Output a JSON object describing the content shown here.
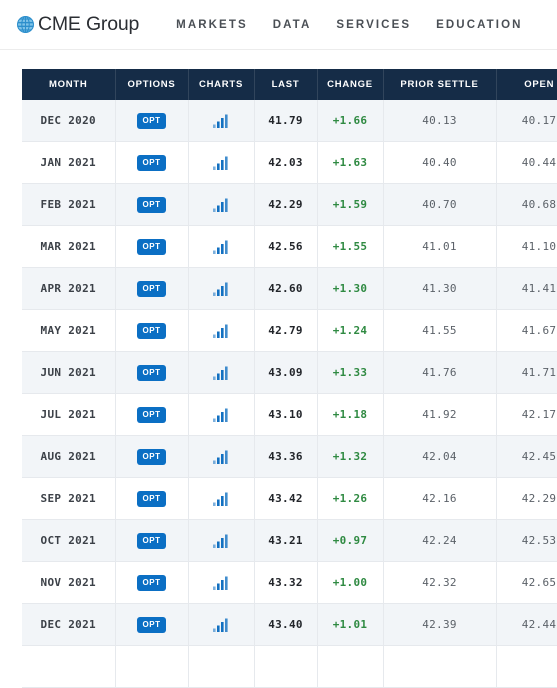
{
  "header": {
    "brand": {
      "name": "CME Group",
      "logo_icon": "globe-icon",
      "logo_color": "#4a9fd8"
    },
    "nav": [
      {
        "label": "MARKETS"
      },
      {
        "label": "DATA"
      },
      {
        "label": "SERVICES"
      },
      {
        "label": "EDUCATION"
      }
    ]
  },
  "quotes_table": {
    "columns": [
      {
        "key": "month",
        "label": "MONTH"
      },
      {
        "key": "options",
        "label": "OPTIONS"
      },
      {
        "key": "charts",
        "label": "CHARTS"
      },
      {
        "key": "last",
        "label": "LAST"
      },
      {
        "key": "change",
        "label": "CHANGE"
      },
      {
        "key": "prior",
        "label": "PRIOR SETTLE"
      },
      {
        "key": "open",
        "label": "OPEN"
      }
    ],
    "colors": {
      "header_bg": "#152c47",
      "header_text": "#ffffff",
      "row_alt_bg": "#f2f5f8",
      "row_bg": "#ffffff",
      "change_positive": "#2f8a42",
      "badge_bg": "#0b6fc4",
      "chart_icon": "#1270c1"
    },
    "option_badge_label": "OPT",
    "option_badge_icon": "opt-badge-icon",
    "chart_cell_icon": "bar-chart-icon",
    "rows": [
      {
        "month": "DEC 2020",
        "options": "OPT",
        "last": "41.79",
        "change": "+1.66",
        "prior": "40.13",
        "open": "40.17"
      },
      {
        "month": "JAN 2021",
        "options": "OPT",
        "last": "42.03",
        "change": "+1.63",
        "prior": "40.40",
        "open": "40.44"
      },
      {
        "month": "FEB 2021",
        "options": "OPT",
        "last": "42.29",
        "change": "+1.59",
        "prior": "40.70",
        "open": "40.68"
      },
      {
        "month": "MAR 2021",
        "options": "OPT",
        "last": "42.56",
        "change": "+1.55",
        "prior": "41.01",
        "open": "41.10"
      },
      {
        "month": "APR 2021",
        "options": "OPT",
        "last": "42.60",
        "change": "+1.30",
        "prior": "41.30",
        "open": "41.41"
      },
      {
        "month": "MAY 2021",
        "options": "OPT",
        "last": "42.79",
        "change": "+1.24",
        "prior": "41.55",
        "open": "41.67"
      },
      {
        "month": "JUN 2021",
        "options": "OPT",
        "last": "43.09",
        "change": "+1.33",
        "prior": "41.76",
        "open": "41.71"
      },
      {
        "month": "JUL 2021",
        "options": "OPT",
        "last": "43.10",
        "change": "+1.18",
        "prior": "41.92",
        "open": "42.17"
      },
      {
        "month": "AUG 2021",
        "options": "OPT",
        "last": "43.36",
        "change": "+1.32",
        "prior": "42.04",
        "open": "42.45"
      },
      {
        "month": "SEP 2021",
        "options": "OPT",
        "last": "43.42",
        "change": "+1.26",
        "prior": "42.16",
        "open": "42.29"
      },
      {
        "month": "OCT 2021",
        "options": "OPT",
        "last": "43.21",
        "change": "+0.97",
        "prior": "42.24",
        "open": "42.53"
      },
      {
        "month": "NOV 2021",
        "options": "OPT",
        "last": "43.32",
        "change": "+1.00",
        "prior": "42.32",
        "open": "42.65"
      },
      {
        "month": "DEC 2021",
        "options": "OPT",
        "last": "43.40",
        "change": "+1.01",
        "prior": "42.39",
        "open": "42.44"
      }
    ]
  }
}
